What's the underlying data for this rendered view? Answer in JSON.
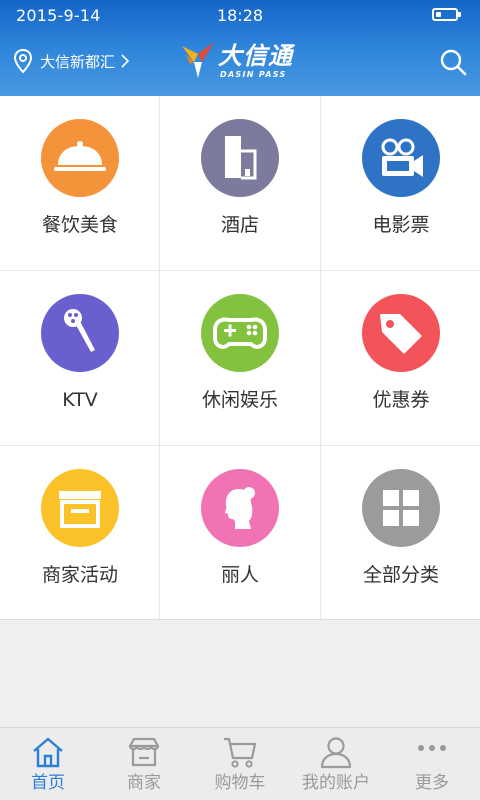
{
  "status_bar": {
    "date": "2015-9-14",
    "time": "18:28",
    "battery_level": 0.25
  },
  "header": {
    "location_label": "大信新都汇",
    "logo_title": "大信通",
    "logo_subtitle": "DASIN PASS",
    "location_icon": "location-pin-icon",
    "search_icon": "search-icon"
  },
  "categories": [
    {
      "label": "餐饮美食",
      "icon": "dining-cloche-icon",
      "color": "#f5933a"
    },
    {
      "label": "酒店",
      "icon": "hotel-building-icon",
      "color": "#7c7b9e"
    },
    {
      "label": "电影票",
      "icon": "movie-camera-icon",
      "color": "#2f73c6"
    },
    {
      "label": "KTV",
      "icon": "microphone-icon",
      "color": "#6a5fce"
    },
    {
      "label": "休闲娱乐",
      "icon": "gamepad-icon",
      "color": "#83c23f"
    },
    {
      "label": "优惠券",
      "icon": "coupon-tag-icon",
      "color": "#f2545a"
    },
    {
      "label": "商家活动",
      "icon": "storefront-icon",
      "color": "#fbc22a"
    },
    {
      "label": "丽人",
      "icon": "woman-profile-icon",
      "color": "#f173b4"
    },
    {
      "label": "全部分类",
      "icon": "grid-four-icon",
      "color": "#9b9b9b"
    }
  ],
  "bottom_nav": {
    "active_index": 0,
    "active_color": "#2a7fd6",
    "inactive_color": "#9a9a9a",
    "items": [
      {
        "label": "首页",
        "icon": "home-icon"
      },
      {
        "label": "商家",
        "icon": "store-icon"
      },
      {
        "label": "购物车",
        "icon": "cart-icon"
      },
      {
        "label": "我的账户",
        "icon": "user-icon"
      },
      {
        "label": "更多",
        "icon": "more-icon"
      }
    ]
  },
  "colors": {
    "header_blue": "#2f86da",
    "page_background": "#efefef"
  }
}
